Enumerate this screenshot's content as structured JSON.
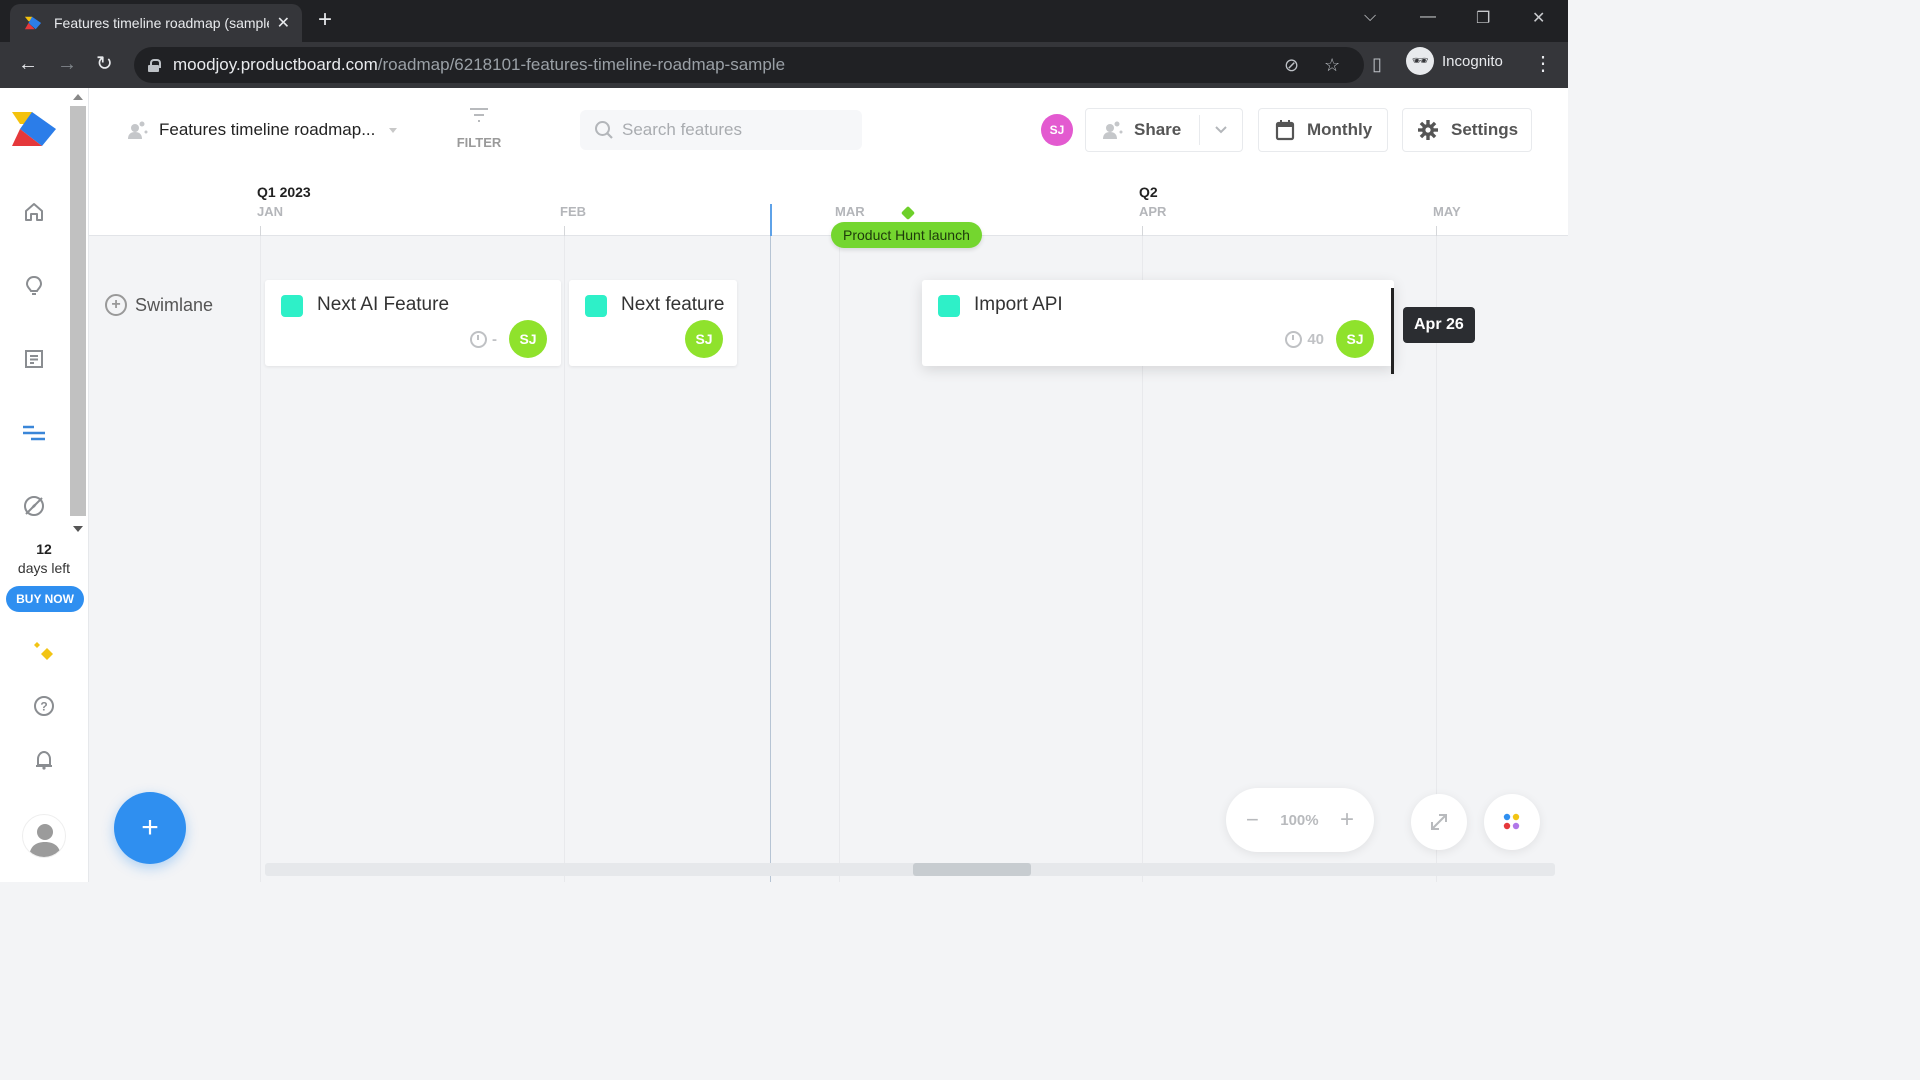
{
  "browser": {
    "tab_title": "Features timeline roadmap (sample)",
    "url_host": "moodjoy.productboard.com",
    "url_path": "/roadmap/6218101-features-timeline-roadmap-sample",
    "profile_label": "Incognito"
  },
  "toolbar": {
    "roadmap_title": "Features timeline roadmap...",
    "filter_label": "FILTER",
    "search_placeholder": "Search features",
    "user_initials": "SJ",
    "share_label": "Share",
    "view_label": "Monthly",
    "settings_label": "Settings"
  },
  "sidebar": {
    "items": [
      {
        "icon": "home-icon"
      },
      {
        "icon": "lightbulb-icon"
      },
      {
        "icon": "notes-icon"
      },
      {
        "icon": "roadmap-icon",
        "active": true
      },
      {
        "icon": "compass-icon"
      }
    ],
    "trial_days": "12",
    "trial_text": "days left",
    "buy_label": "BUY NOW"
  },
  "timeline": {
    "quarters": [
      {
        "label": "Q1 2023"
      },
      {
        "label": "Q2"
      }
    ],
    "months": [
      "JAN",
      "FEB",
      "MAR",
      "APR",
      "MAY"
    ],
    "milestone": {
      "label": "Product Hunt launch",
      "color": "#74d62f"
    },
    "swimlane_label": "Swimlane",
    "cards": [
      {
        "title": "Next AI Feature",
        "effort": "-",
        "owner": "SJ",
        "color": "#2ef0c8"
      },
      {
        "title": "Next feature",
        "owner": "SJ",
        "color": "#2ef0c8"
      },
      {
        "title": "Import API",
        "effort": "40",
        "owner": "SJ",
        "color": "#2ef0c8"
      }
    ],
    "resize_tooltip": "Apr 26"
  },
  "controls": {
    "zoom_level": "100%",
    "add_label": "+"
  },
  "colors": {
    "accent": "#2f8ff0",
    "avatar_pink": "#e35ad0",
    "avatar_green": "#8fe22c"
  }
}
